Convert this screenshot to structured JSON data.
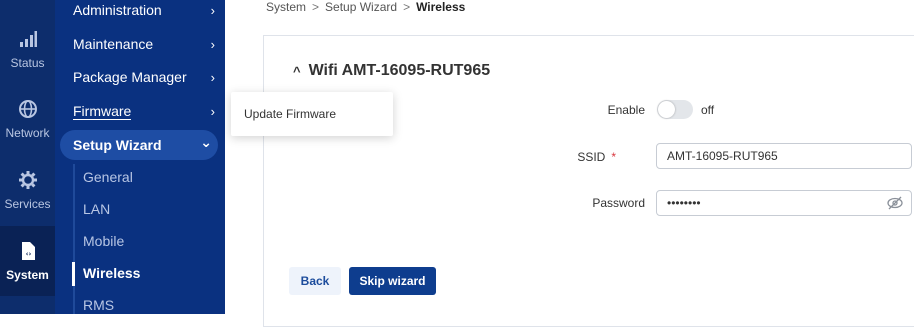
{
  "rail": {
    "items": [
      {
        "label": "Status",
        "icon": "signal-bars-icon"
      },
      {
        "label": "Network",
        "icon": "globe-icon"
      },
      {
        "label": "Services",
        "icon": "gear-icon"
      },
      {
        "label": "System",
        "icon": "code-file-icon"
      }
    ]
  },
  "menu": {
    "items": [
      {
        "label": "Administration"
      },
      {
        "label": "Maintenance"
      },
      {
        "label": "Package Manager"
      },
      {
        "label": "Firmware"
      },
      {
        "label": "Setup Wizard"
      }
    ],
    "chev_right": "›",
    "chev_down": "⌄",
    "wizard_sub": [
      "General",
      "LAN",
      "Mobile",
      "Wireless",
      "RMS"
    ]
  },
  "popup": {
    "label": "Update Firmware"
  },
  "breadcrumb": {
    "items": [
      "System",
      "Setup Wizard",
      "Wireless"
    ],
    "separator": ">"
  },
  "section": {
    "title": "Wifi AMT-16095-RUT965",
    "caret": "^"
  },
  "form": {
    "enable_label": "Enable",
    "enable_state": "off",
    "ssid_label": "SSID",
    "required_mark": "*",
    "ssid_value": "AMT-16095-RUT965",
    "password_label": "Password",
    "password_value": "••••••••"
  },
  "buttons": {
    "back": "Back",
    "skip": "Skip wizard"
  },
  "colors": {
    "rail_bg": "#0d2d6c",
    "menu_bg": "#0a3180",
    "primary": "#0e3d8e",
    "required": "#d9363e"
  }
}
